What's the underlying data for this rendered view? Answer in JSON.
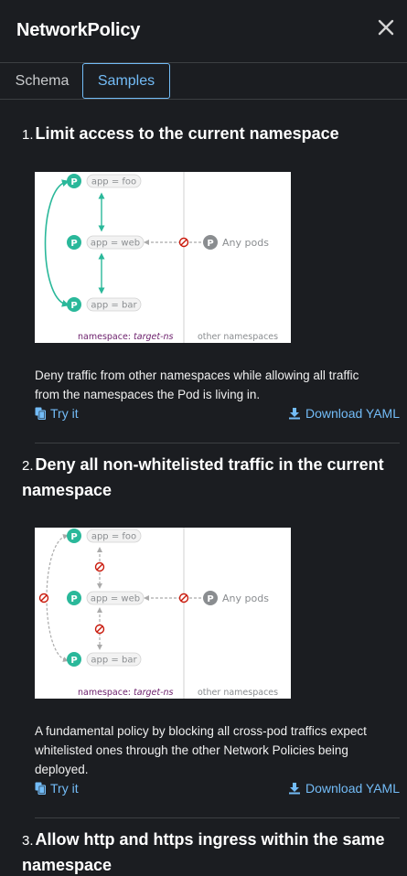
{
  "header": {
    "title": "NetworkPolicy"
  },
  "tabs": [
    {
      "label": "Schema"
    },
    {
      "label": "Samples"
    }
  ],
  "samples": [
    {
      "number": "1.",
      "title": "Limit access to the current namespace",
      "description": "Deny traffic from other namespaces while allowing all traffic from the namespaces the Pod is living in.",
      "try_label": "Try it",
      "download_label": "Download YAML",
      "diagram": {
        "pod_badge": "P",
        "pods": [
          "app = foo",
          "app = web",
          "app = bar"
        ],
        "any_pods": "Any pods",
        "namespace_prefix": "namespace: ",
        "namespace_name": "target-ns",
        "other_namespaces": "other namespaces"
      }
    },
    {
      "number": "2.",
      "title": "Deny all non-whitelisted traffic in the current namespace",
      "description": "A fundamental policy by blocking all cross-pod traffics expect whitelisted ones through the other Network Policies being deployed.",
      "try_label": "Try it",
      "download_label": "Download YAML",
      "diagram": {
        "pod_badge": "P",
        "pods": [
          "app = foo",
          "app = web",
          "app = bar"
        ],
        "any_pods": "Any pods",
        "namespace_prefix": "namespace: ",
        "namespace_name": "target-ns",
        "other_namespaces": "other namespaces"
      }
    },
    {
      "number": "3.",
      "title": "Allow http and https ingress within the same namespace"
    }
  ],
  "colors": {
    "accent": "#73bcf7",
    "pod_green": "#2ab89a",
    "deny_red": "#c9190b",
    "namespace_purple": "#6b1e6b",
    "pod_gray": "#8a8d90"
  }
}
